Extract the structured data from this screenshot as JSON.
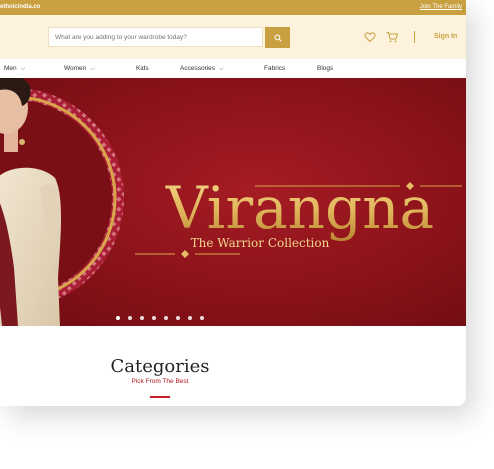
{
  "topbar": {
    "domain_text": "ethnicindia.co",
    "join_link": "Join The Family"
  },
  "header": {
    "search_placeholder": "What are you adding to your wardrobe today?",
    "signin_label": "Sign In",
    "icons": [
      "search-icon",
      "heart-icon",
      "cart-icon"
    ]
  },
  "nav": {
    "items": [
      {
        "label": "Men",
        "has_dropdown": true
      },
      {
        "label": "Women",
        "has_dropdown": true
      },
      {
        "label": "Kids",
        "has_dropdown": false
      },
      {
        "label": "Accessories",
        "has_dropdown": true
      },
      {
        "label": "Fabrics",
        "has_dropdown": false
      },
      {
        "label": "Blogs",
        "has_dropdown": false
      }
    ],
    "dropdown_glyph": "⌵"
  },
  "banner": {
    "title": "Virangna",
    "subtitle": "The Warrior Collection",
    "carousel_dots": 8,
    "active_dot": 1
  },
  "categories": {
    "title": "Categories",
    "subtitle": "Pick From The Best"
  },
  "colors": {
    "gold": "#c8a040",
    "cream": "#fdf3dc",
    "maroon": "#8a1219",
    "accent_red": "#c8202a"
  }
}
